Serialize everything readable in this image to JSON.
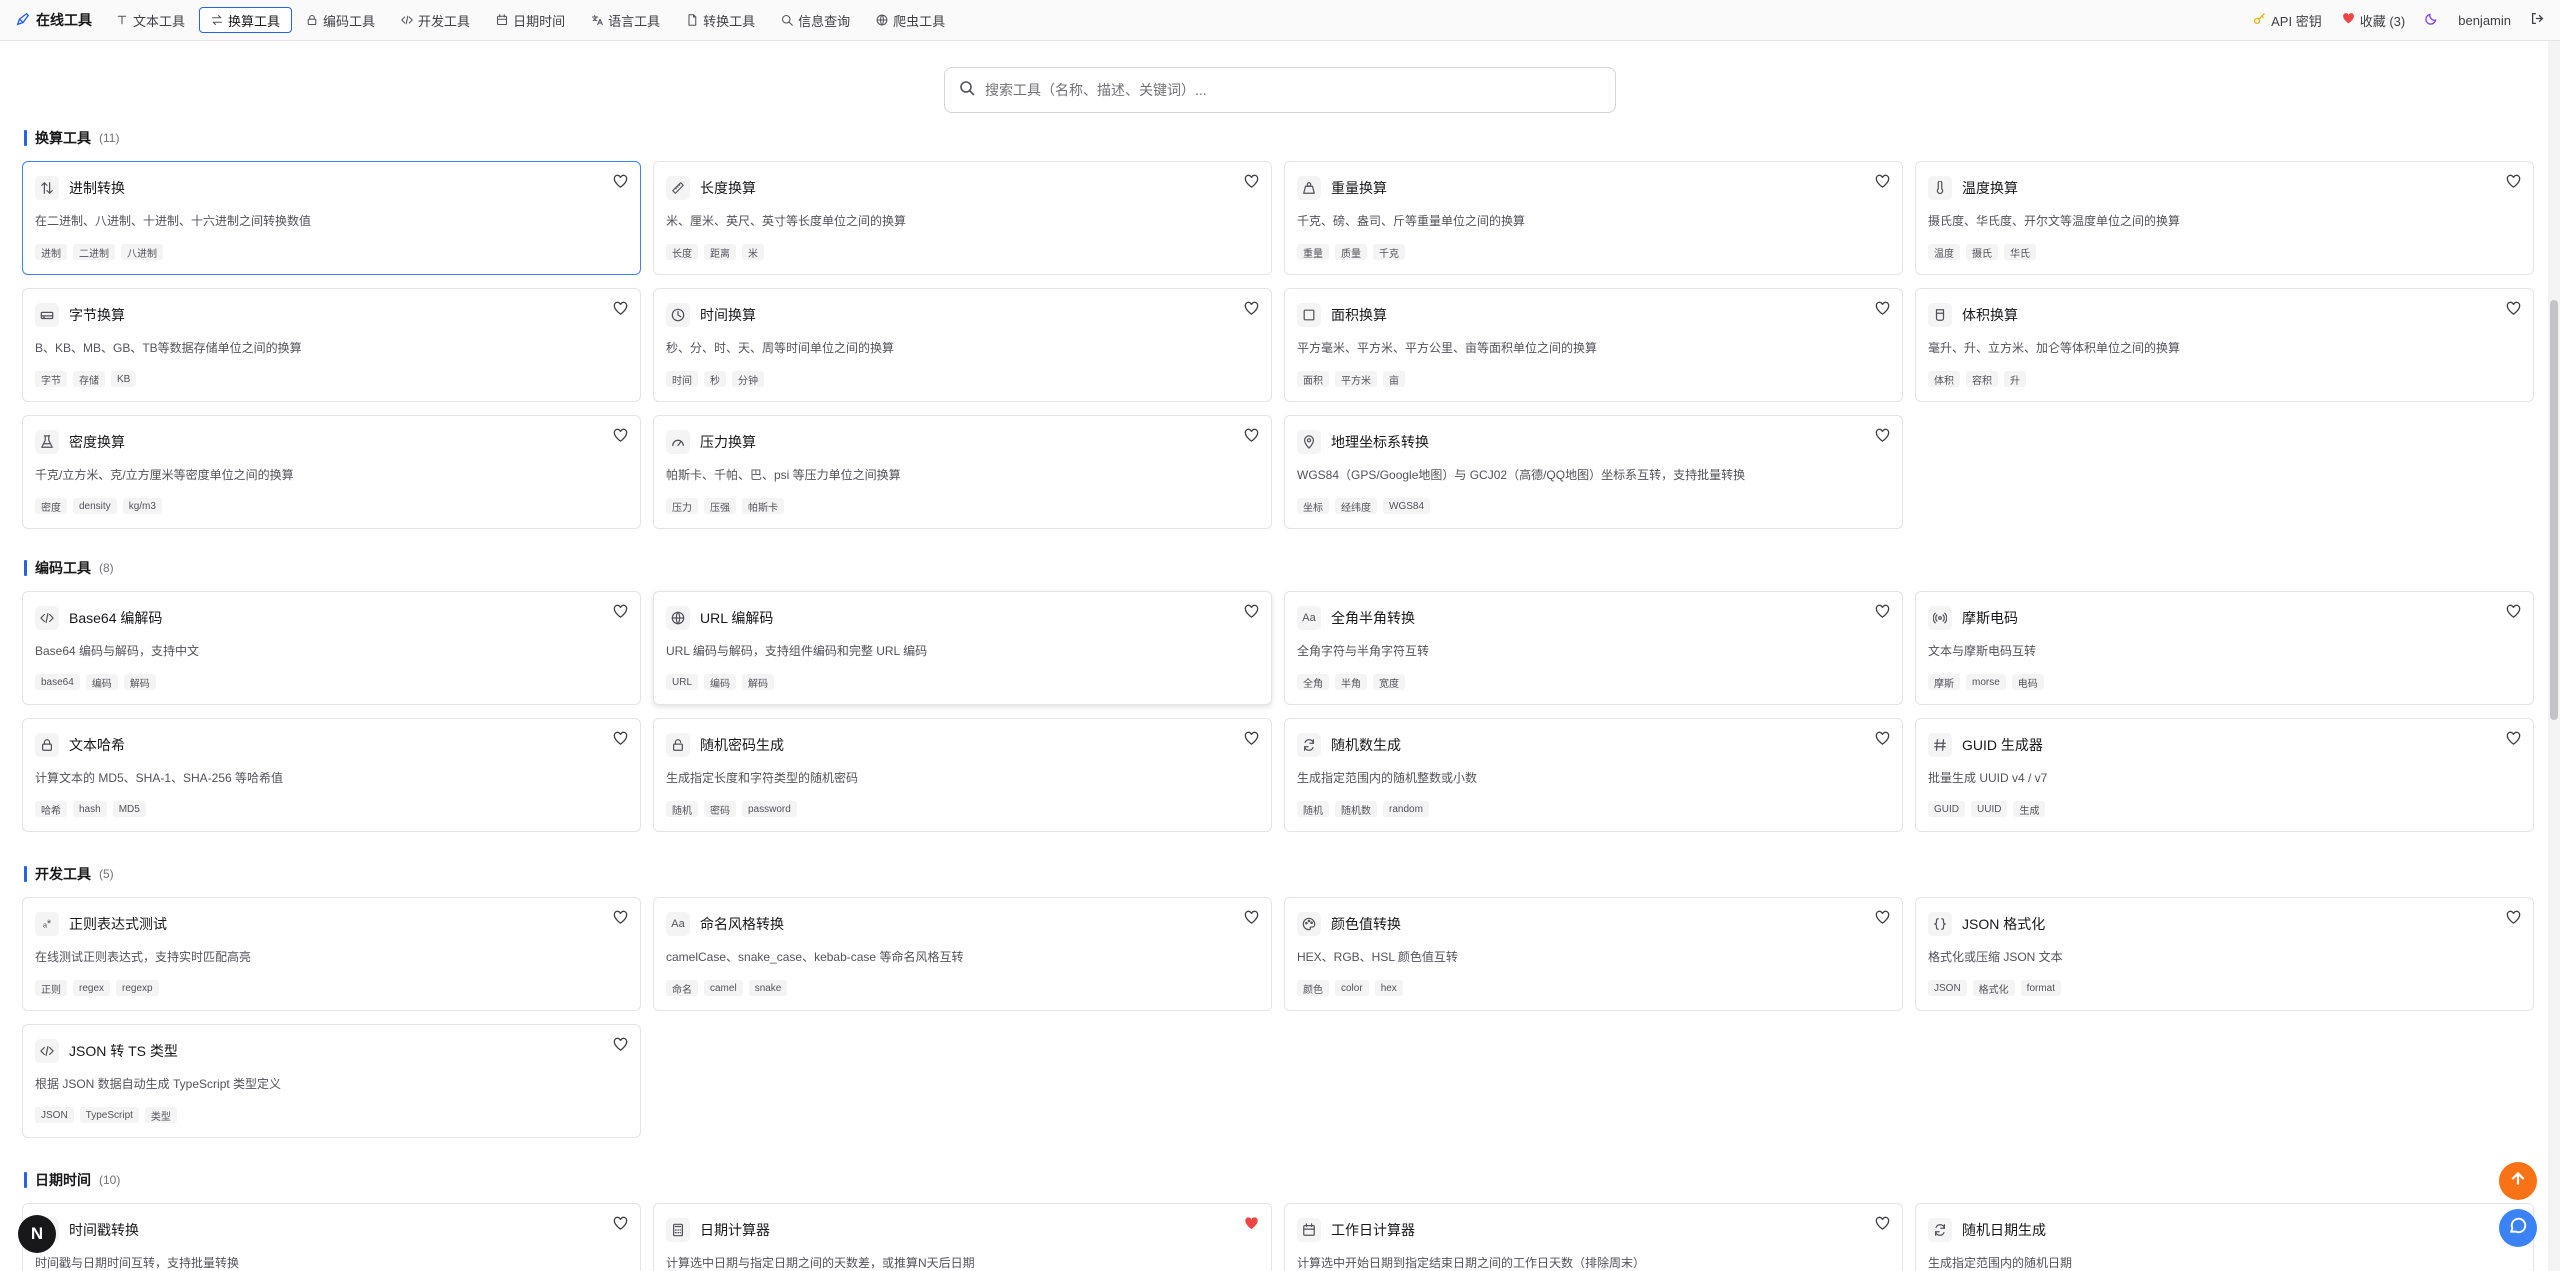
{
  "nav": {
    "brand": "在线工具",
    "items": [
      {
        "label": "文本工具",
        "icon": "type-icon",
        "active": false
      },
      {
        "label": "换算工具",
        "icon": "arrows-swap-icon",
        "active": true
      },
      {
        "label": "编码工具",
        "icon": "lock-icon",
        "active": false
      },
      {
        "label": "开发工具",
        "icon": "code-icon",
        "active": false
      },
      {
        "label": "日期时间",
        "icon": "calendar-icon",
        "active": false
      },
      {
        "label": "语言工具",
        "icon": "language-icon",
        "active": false
      },
      {
        "label": "转换工具",
        "icon": "file-icon",
        "active": false
      },
      {
        "label": "信息查询",
        "icon": "search-icon",
        "active": false
      },
      {
        "label": "爬虫工具",
        "icon": "globe-icon",
        "active": false
      }
    ],
    "api_key": "API 密钥",
    "favorites": "收藏 (3)",
    "username": "benjamin"
  },
  "search": {
    "placeholder": "搜索工具（名称、描述、关键词）..."
  },
  "sections": [
    {
      "title": "换算工具",
      "count": "(11)",
      "cards": [
        {
          "title": "进制转换",
          "desc": "在二进制、八进制、十进制、十六进制之间转换数值",
          "tags": [
            "进制",
            "二进制",
            "八进制"
          ],
          "icon": "arrows-updown-icon",
          "favorite": false,
          "selected": true
        },
        {
          "title": "长度换算",
          "desc": "米、厘米、英尺、英寸等长度单位之间的换算",
          "tags": [
            "长度",
            "距离",
            "米"
          ],
          "icon": "ruler-icon",
          "favorite": false
        },
        {
          "title": "重量换算",
          "desc": "千克、磅、盎司、斤等重量单位之间的换算",
          "tags": [
            "重量",
            "质量",
            "千克"
          ],
          "icon": "weight-icon",
          "favorite": false
        },
        {
          "title": "温度换算",
          "desc": "摄氏度、华氏度、开尔文等温度单位之间的换算",
          "tags": [
            "温度",
            "摄氏",
            "华氏"
          ],
          "icon": "thermometer-icon",
          "favorite": false
        },
        {
          "title": "字节换算",
          "desc": "B、KB、MB、GB、TB等数据存储单位之间的换算",
          "tags": [
            "字节",
            "存储",
            "KB"
          ],
          "icon": "harddrive-icon",
          "favorite": false
        },
        {
          "title": "时间换算",
          "desc": "秒、分、时、天、周等时间单位之间的换算",
          "tags": [
            "时间",
            "秒",
            "分钟"
          ],
          "icon": "clock-icon",
          "favorite": false
        },
        {
          "title": "面积换算",
          "desc": "平方毫米、平方米、平方公里、亩等面积单位之间的换算",
          "tags": [
            "面积",
            "平方米",
            "亩"
          ],
          "icon": "square-icon",
          "favorite": false
        },
        {
          "title": "体积换算",
          "desc": "毫升、升、立方米、加仑等体积单位之间的换算",
          "tags": [
            "体积",
            "容积",
            "升"
          ],
          "icon": "cup-icon",
          "favorite": false
        },
        {
          "title": "密度换算",
          "desc": "千克/立方米、克/立方厘米等密度单位之间的换算",
          "tags": [
            "密度",
            "density",
            "kg/m3"
          ],
          "icon": "flask-icon",
          "favorite": false
        },
        {
          "title": "压力换算",
          "desc": "帕斯卡、千帕、巴、psi 等压力单位之间换算",
          "tags": [
            "压力",
            "压强",
            "帕斯卡"
          ],
          "icon": "gauge-icon",
          "favorite": false
        },
        {
          "title": "地理坐标系转换",
          "desc": "WGS84（GPS/Google地图）与 GCJ02（高德/QQ地图）坐标系互转，支持批量转换",
          "tags": [
            "坐标",
            "经纬度",
            "WGS84"
          ],
          "icon": "map-pin-icon",
          "favorite": false
        }
      ]
    },
    {
      "title": "编码工具",
      "count": "(8)",
      "cards": [
        {
          "title": "Base64 编解码",
          "desc": "Base64 编码与解码，支持中文",
          "tags": [
            "base64",
            "编码",
            "解码"
          ],
          "icon": "code-icon",
          "favorite": false
        },
        {
          "title": "URL 编解码",
          "desc": "URL 编码与解码，支持组件编码和完整 URL 编码",
          "tags": [
            "URL",
            "编码",
            "解码"
          ],
          "icon": "globe-icon",
          "favorite": false,
          "raised": true
        },
        {
          "title": "全角半角转换",
          "desc": "全角字符与半角字符互转",
          "tags": [
            "全角",
            "半角",
            "宽度"
          ],
          "icon": "aa-icon",
          "favorite": false
        },
        {
          "title": "摩斯电码",
          "desc": "文本与摩斯电码互转",
          "tags": [
            "摩斯",
            "morse",
            "电码"
          ],
          "icon": "radio-icon",
          "favorite": false
        },
        {
          "title": "文本哈希",
          "desc": "计算文本的 MD5、SHA-1、SHA-256 等哈希值",
          "tags": [
            "哈希",
            "hash",
            "MD5"
          ],
          "icon": "lock-icon",
          "favorite": false
        },
        {
          "title": "随机密码生成",
          "desc": "生成指定长度和字符类型的随机密码",
          "tags": [
            "随机",
            "密码",
            "password"
          ],
          "icon": "lock-open-icon",
          "favorite": false
        },
        {
          "title": "随机数生成",
          "desc": "生成指定范围内的随机整数或小数",
          "tags": [
            "随机",
            "随机数",
            "random"
          ],
          "icon": "refresh-icon",
          "favorite": false
        },
        {
          "title": "GUID 生成器",
          "desc": "批量生成 UUID v4 / v7",
          "tags": [
            "GUID",
            "UUID",
            "生成"
          ],
          "icon": "hash-icon",
          "favorite": false
        }
      ]
    },
    {
      "title": "开发工具",
      "count": "(5)",
      "cards": [
        {
          "title": "正则表达式测试",
          "desc": "在线测试正则表达式，支持实时匹配高亮",
          "tags": [
            "正则",
            "regex",
            "regexp"
          ],
          "icon": "regex-icon",
          "favorite": false
        },
        {
          "title": "命名风格转换",
          "desc": "camelCase、snake_case、kebab-case 等命名风格互转",
          "tags": [
            "命名",
            "camel",
            "snake"
          ],
          "icon": "aa-icon",
          "favorite": false
        },
        {
          "title": "颜色值转换",
          "desc": "HEX、RGB、HSL 颜色值互转",
          "tags": [
            "颜色",
            "color",
            "hex"
          ],
          "icon": "palette-icon",
          "favorite": false
        },
        {
          "title": "JSON 格式化",
          "desc": "格式化或压缩 JSON 文本",
          "tags": [
            "JSON",
            "格式化",
            "format"
          ],
          "icon": "braces-icon",
          "favorite": false
        },
        {
          "title": "JSON 转 TS 类型",
          "desc": "根据 JSON 数据自动生成 TypeScript 类型定义",
          "tags": [
            "JSON",
            "TypeScript",
            "类型"
          ],
          "icon": "code-icon",
          "favorite": false
        }
      ]
    },
    {
      "title": "日期时间",
      "count": "(10)",
      "cards": [
        {
          "title": "时间戳转换",
          "desc": "时间戳与日期时间互转，支持批量转换",
          "tags": [],
          "icon": "clock-icon",
          "favorite": false
        },
        {
          "title": "日期计算器",
          "desc": "计算选中日期与指定日期之间的天数差，或推算N天后日期",
          "tags": [],
          "icon": "calculator-icon",
          "favorite": true
        },
        {
          "title": "工作日计算器",
          "desc": "计算选中开始日期到指定结束日期之间的工作日天数（排除周末）",
          "tags": [],
          "icon": "calendar-icon",
          "favorite": false
        },
        {
          "title": "随机日期生成",
          "desc": "生成指定范围内的随机日期",
          "tags": [],
          "icon": "refresh-icon",
          "favorite": false
        }
      ]
    }
  ],
  "fab": {
    "n_label": "N"
  },
  "colors": {
    "accent": "#2563eb",
    "heart_active": "#ef4444",
    "fab_top": "#f97316",
    "fab_chat": "#3b82f6"
  }
}
